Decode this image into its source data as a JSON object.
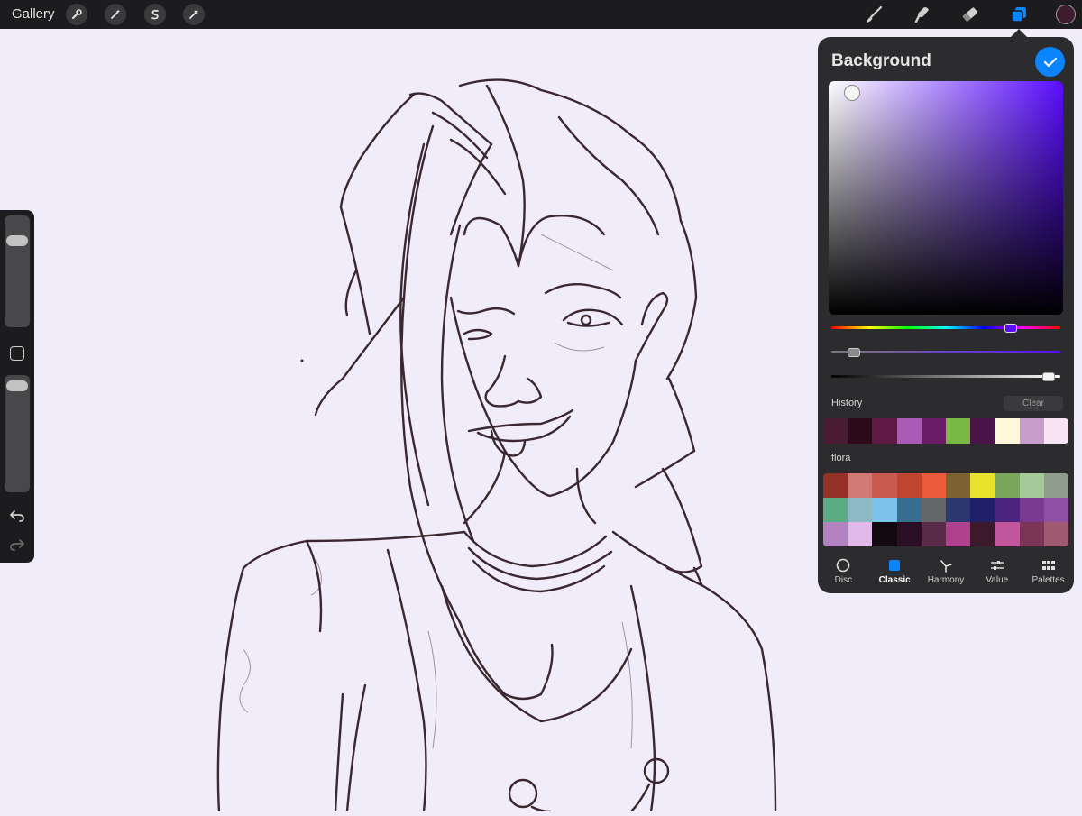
{
  "toolbar": {
    "gallery_label": "Gallery",
    "left_tools": [
      "wrench-icon",
      "magic-wand-icon",
      "selection-s-icon",
      "transform-arrow-icon"
    ],
    "right_tools": [
      "brush-icon",
      "smudge-icon",
      "eraser-icon",
      "layers-icon"
    ],
    "active_color": "#3d1d2e"
  },
  "canvas": {
    "background": "#f1ecfa",
    "stroke_color": "#3a2730"
  },
  "sidebar": {
    "brush_size_level": 0.2,
    "opacity_level": 0.05
  },
  "color_panel": {
    "title": "Background",
    "confirm_icon": "checkmark-icon",
    "hue_level": 0.78,
    "saturation_level": 0.07,
    "value_level": 0.97,
    "history_label": "History",
    "clear_label": "Clear",
    "history_colors": [
      "#4a1c33",
      "#2c0a1a",
      "#5e1a45",
      "#a95cb5",
      "#6a1d66",
      "#7ab844",
      "#4b1448",
      "#fff6dc",
      "#c79dcc",
      "#f7e5f5"
    ],
    "palette_label": "flora",
    "palette_colors": [
      "#943228",
      "#d07a73",
      "#c95a4f",
      "#c0452f",
      "#ec5c3a",
      "#7d6233",
      "#e8e22c",
      "#7aa65b",
      "#a6c99a",
      "#8e9d8d",
      "#5bab85",
      "#8db8c6",
      "#7bc3ea",
      "#376d8e",
      "#646669",
      "#2b3870",
      "#1f2068",
      "#4b2480",
      "#7a3a91",
      "#8e4fa5",
      "#b283c0",
      "#e1b9e9",
      "#12080f",
      "#2a0f24",
      "#5a2a49",
      "#b0418f",
      "#3d1a2b",
      "#c3579e",
      "#7a3555",
      "#9f5a72"
    ],
    "tabs": [
      {
        "label": "Disc",
        "icon": "disc-icon"
      },
      {
        "label": "Classic",
        "icon": "classic-square-icon"
      },
      {
        "label": "Harmony",
        "icon": "harmony-icon"
      },
      {
        "label": "Value",
        "icon": "value-sliders-icon"
      },
      {
        "label": "Palettes",
        "icon": "palettes-grid-icon"
      }
    ],
    "active_tab": "Classic"
  }
}
